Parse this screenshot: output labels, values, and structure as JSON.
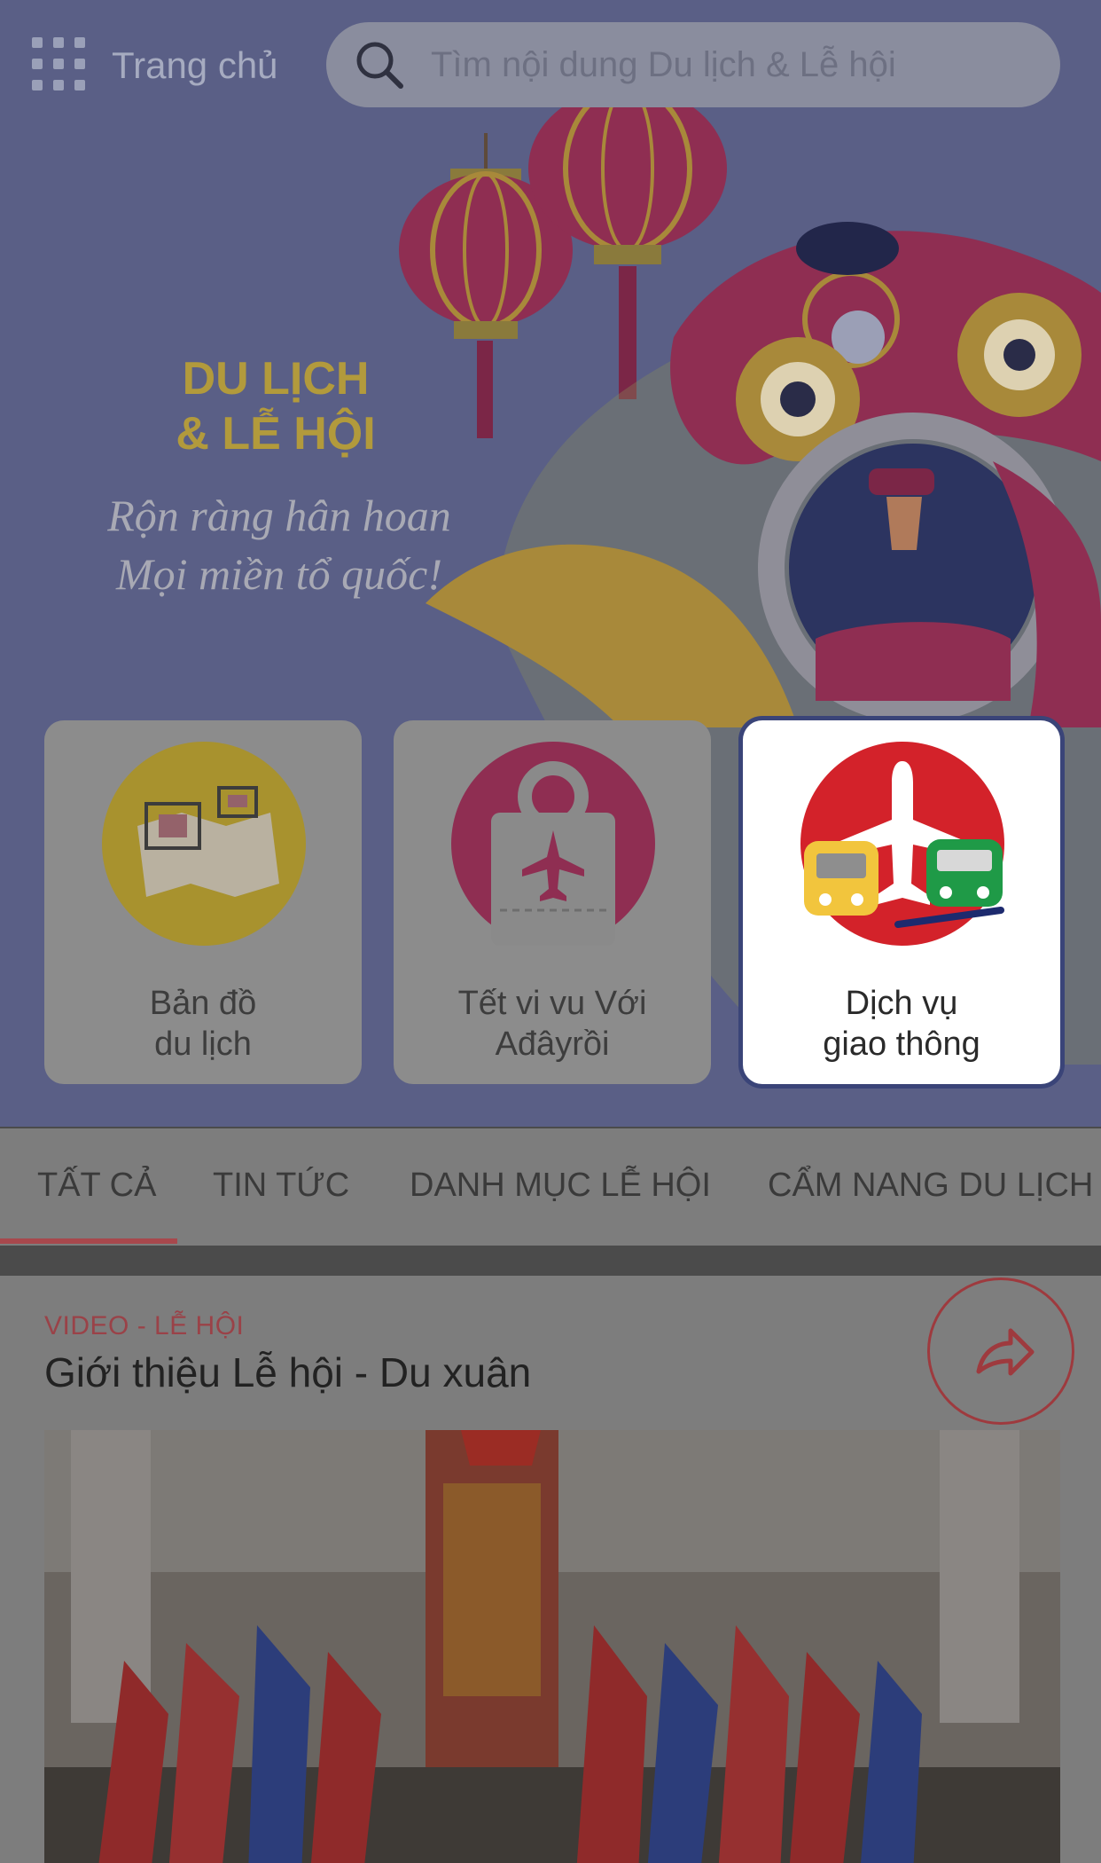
{
  "header": {
    "home_label": "Trang chủ",
    "search_placeholder": "Tìm nội dung Du lịch & Lễ hội"
  },
  "hero": {
    "title_line1": "DU LỊCH",
    "title_line2": "& LỄ HỘI",
    "subtitle_line1": "Rộn ràng hân hoan",
    "subtitle_line2": "Mọi miền tổ quốc!"
  },
  "cards": [
    {
      "line1": "Bản đồ",
      "line2": "du lịch",
      "icon": "map-icon"
    },
    {
      "line1": "Tết vi vu Với",
      "line2": "Ađâyrồi",
      "icon": "flight-ticket-icon"
    },
    {
      "line1": "Dịch vụ",
      "line2": "giao thông",
      "icon": "transport-icon"
    }
  ],
  "tabs": [
    {
      "label": "TẤT CẢ"
    },
    {
      "label": "TIN TỨC"
    },
    {
      "label": "DANH MỤC LỄ HỘI"
    },
    {
      "label": "CẨM NANG DU LỊCH"
    }
  ],
  "post": {
    "category": "VIDEO - LỄ HỘI",
    "title": "Giới thiệu Lễ hội - Du xuân"
  },
  "colors": {
    "accent": "#d3222a",
    "hero_bg": "#5a5f86",
    "gold": "#b29a3c"
  }
}
